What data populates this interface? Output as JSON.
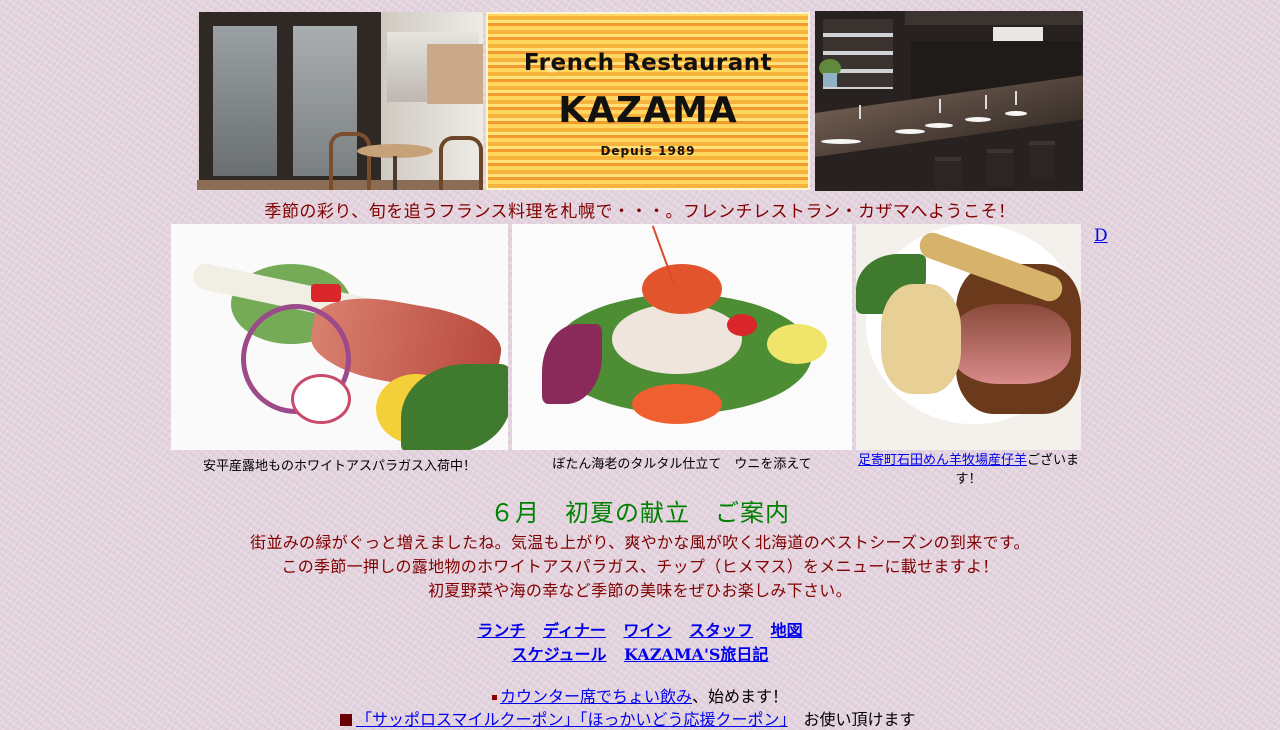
{
  "header": {
    "logo_line1": "French Restaurant",
    "logo_line2": "KAZAMA",
    "logo_line3": "Depuis  1989",
    "tagline": "季節の彩り、旬を追うフランス料理を札幌で・・・。フレンチレストラン・カザマへようこそ！"
  },
  "dishes": {
    "caption1": "安平産露地ものホワイトアスパラガス入荷中！",
    "caption2": "ぼたん海老のタルタル仕立て　ウニを添えて",
    "caption3_link": "足寄町石田めん羊牧場産仔羊",
    "caption3_suffix": "ございます！"
  },
  "side_link": "D",
  "main": {
    "title": "６月　初夏の献立　ご案内",
    "intro_line1": "街並みの緑がぐっと増えましたね。気温も上がり、爽やかな風が吹く北海道のベストシーズンの到来です。",
    "intro_line2": "この季節一押しの露地物のホワイトアスパラガス、チップ（ヒメマス）をメニューに載せますよ！",
    "intro_line3": "初夏野菜や海の幸など季節の美味をぜひお楽しみ下さい。"
  },
  "nav": {
    "lunch": "ランチ",
    "dinner": "ディナー",
    "wine": "ワイン",
    "staff": "スタッフ",
    "map": "地図",
    "schedule": "スケジュール",
    "travel": "KAZAMA'S旅日記"
  },
  "news": {
    "item1_link": "カウンター席でちょい飲み",
    "item1_suffix": "、始めます！",
    "item2_link": "「サッポロスマイルクーポン」「ほっかいどう応援クーポン」",
    "item2_suffix": "　お使い頂けます"
  },
  "colors": {
    "tagline": "#800000",
    "title": "#008000",
    "link": "#0000ee",
    "background": "#e3d3de"
  }
}
